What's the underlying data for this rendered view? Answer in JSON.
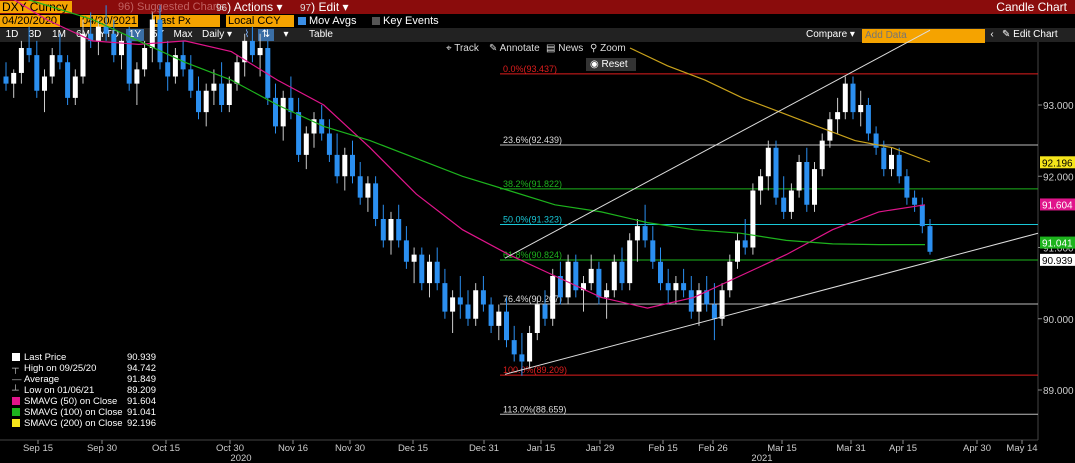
{
  "header": {
    "ticker": "DXY Curncy",
    "suggested_label": "Suggested Charts",
    "suggested_num": "96",
    "actions_label": "Actions",
    "actions_num": "96",
    "edit_label": "Edit",
    "edit_num": "97",
    "chart_type": "Candle Chart"
  },
  "controls": {
    "start_date": "04/20/2020",
    "end_date": "04/20/2021",
    "price_field": "Last Px",
    "currency": "Local CCY",
    "mov_avgs_label": "Mov Avgs",
    "key_events_label": "Key Events",
    "ranges": [
      "1D",
      "3D",
      "1M",
      "6M",
      "YTD",
      "1Y",
      "5Y",
      "Max"
    ],
    "selected_range": "1Y",
    "frequency": "Daily",
    "table_label": "Table",
    "compare_label": "Compare",
    "add_data_placeholder": "Add Data",
    "edit_chart_label": "Edit Chart"
  },
  "toolbar": {
    "track": "Track",
    "annotate": "Annotate",
    "news": "News",
    "zoom": "Zoom",
    "reset": "Reset"
  },
  "legend": [
    {
      "label": "Last Price",
      "value": "90.939",
      "marker": "square",
      "color": "#ffffff"
    },
    {
      "label": "High on 09/25/20",
      "value": "94.742",
      "marker": "high",
      "color": "#ffffff"
    },
    {
      "label": "Average",
      "value": "91.849",
      "marker": "avg",
      "color": "#ffffff"
    },
    {
      "label": "Low on 01/06/21",
      "value": "89.209",
      "marker": "low",
      "color": "#ffffff"
    },
    {
      "label": "SMAVG (50)  on Close",
      "value": "91.604",
      "marker": "square",
      "color": "#e0158b"
    },
    {
      "label": "SMAVG (100)  on Close",
      "value": "91.041",
      "marker": "square",
      "color": "#1db31d"
    },
    {
      "label": "SMAVG (200)  on Close",
      "value": "92.196",
      "marker": "square",
      "color": "#f5e51b"
    }
  ],
  "chart_data": {
    "type": "candlestick",
    "ylim": [
      88.3,
      94.1
    ],
    "y_ticks": [
      "93.000",
      "92.000",
      "91.000",
      "90.000",
      "89.000"
    ],
    "x_tick_labels": [
      "Sep 15",
      "Sep 30",
      "Oct 15",
      "Oct 30",
      "Nov 16",
      "Nov 30",
      "Dec 15",
      "Dec 31",
      "Jan 15",
      "Jan 29",
      "Feb 15",
      "Feb 26",
      "Mar 15",
      "Mar 31",
      "Apr 15",
      "Apr 30",
      "May 14"
    ],
    "year_labels": [
      "2020",
      "2021"
    ],
    "fib_levels": [
      {
        "label": "0.0%(93.437)",
        "value": 93.437,
        "color": "#e01e1e"
      },
      {
        "label": "23.6%(92.439)",
        "value": 92.439,
        "color": "#bbbbbb"
      },
      {
        "label": "38.2%(91.822)",
        "value": 91.822,
        "color": "#1db31d"
      },
      {
        "label": "50.0%(91.323)",
        "value": 91.323,
        "color": "#19c8d8"
      },
      {
        "label": "61.8%(90.824)",
        "value": 90.824,
        "color": "#1db31d"
      },
      {
        "label": "76.4%(90.207)",
        "value": 90.207,
        "color": "#bbbbbb"
      },
      {
        "label": "100.0%(89.209)",
        "value": 89.209,
        "color": "#e01e1e"
      },
      {
        "label": "113.0%(88.659)",
        "value": 88.659,
        "color": "#bbbbbb"
      }
    ],
    "price_tags": [
      {
        "label": "92.196",
        "value": 92.196,
        "bg": "#f5e51b",
        "fg": "#000000"
      },
      {
        "label": "91.604",
        "value": 91.604,
        "bg": "#e0158b",
        "fg": "#ffffff"
      },
      {
        "label": "91.041",
        "value": 91.041,
        "bg": "#1db31d",
        "fg": "#ffffff"
      },
      {
        "label": "90.939",
        "value": 90.939,
        "bg": "#ffffff",
        "fg": "#000000"
      }
    ],
    "trendlines": [
      {
        "name": "upper-channel",
        "from": [
          "Jan 06",
          90.85
        ],
        "to": [
          "Apr 15",
          94.0
        ]
      },
      {
        "name": "lower-channel",
        "from": [
          "Jan 06",
          89.22
        ],
        "to": [
          "May 14",
          91.2
        ]
      }
    ],
    "sma50": [
      94.6,
      94.2,
      93.9,
      93.85,
      93.9,
      93.75,
      93.35,
      93.0,
      92.4,
      91.75,
      91.25,
      90.9,
      90.6,
      90.3,
      90.15,
      90.3,
      90.6,
      90.9,
      91.25,
      91.5,
      91.6
    ],
    "sma100": [
      94.6,
      94.4,
      94.2,
      93.9,
      93.6,
      93.35,
      93.0,
      92.7,
      92.5,
      92.25,
      92.0,
      91.8,
      91.6,
      91.5,
      91.35,
      91.25,
      91.2,
      91.1,
      91.05,
      91.04,
      91.04
    ],
    "sma200": [
      93.8,
      93.55,
      93.35,
      93.1,
      92.9,
      92.7,
      92.5,
      92.4,
      92.2
    ],
    "candles": [
      [
        93.4,
        93.6,
        93.2,
        93.3
      ],
      [
        93.3,
        93.5,
        93.1,
        93.45
      ],
      [
        93.45,
        93.9,
        93.3,
        93.8
      ],
      [
        93.8,
        94.1,
        93.6,
        93.7
      ],
      [
        93.7,
        93.9,
        93.1,
        93.2
      ],
      [
        93.2,
        93.5,
        92.9,
        93.4
      ],
      [
        93.4,
        93.8,
        93.3,
        93.7
      ],
      [
        93.7,
        94.0,
        93.5,
        93.6
      ],
      [
        93.6,
        93.7,
        93.0,
        93.1
      ],
      [
        93.1,
        93.5,
        93.0,
        93.4
      ],
      [
        93.4,
        94.2,
        93.3,
        94.0
      ],
      [
        94.0,
        94.3,
        93.8,
        93.9
      ],
      [
        93.9,
        94.2,
        93.7,
        94.1
      ],
      [
        94.1,
        94.4,
        93.9,
        94.0
      ],
      [
        94.0,
        94.2,
        93.6,
        93.7
      ],
      [
        93.7,
        94.0,
        93.5,
        93.9
      ],
      [
        93.9,
        94.1,
        93.2,
        93.3
      ],
      [
        93.3,
        93.6,
        93.0,
        93.5
      ],
      [
        93.5,
        93.9,
        93.4,
        93.8
      ],
      [
        93.8,
        94.3,
        93.6,
        94.2
      ],
      [
        94.2,
        94.4,
        93.5,
        93.6
      ],
      [
        93.6,
        93.9,
        93.2,
        93.4
      ],
      [
        93.4,
        93.8,
        93.3,
        93.7
      ],
      [
        93.7,
        93.9,
        93.4,
        93.5
      ],
      [
        93.5,
        93.7,
        93.1,
        93.2
      ],
      [
        93.2,
        93.4,
        92.8,
        92.9
      ],
      [
        92.9,
        93.3,
        92.7,
        93.2
      ],
      [
        93.2,
        93.5,
        93.0,
        93.3
      ],
      [
        93.3,
        93.6,
        92.9,
        93.0
      ],
      [
        93.0,
        93.4,
        92.9,
        93.3
      ],
      [
        93.3,
        93.7,
        93.2,
        93.6
      ],
      [
        93.6,
        94.0,
        93.4,
        93.9
      ],
      [
        93.9,
        94.1,
        93.6,
        93.7
      ],
      [
        93.7,
        94.0,
        93.4,
        93.8
      ],
      [
        93.8,
        93.9,
        93.0,
        93.1
      ],
      [
        93.1,
        93.3,
        92.6,
        92.7
      ],
      [
        92.7,
        93.2,
        92.5,
        93.1
      ],
      [
        93.1,
        93.4,
        92.8,
        92.9
      ],
      [
        92.9,
        93.1,
        92.2,
        92.3
      ],
      [
        92.3,
        92.7,
        92.1,
        92.6
      ],
      [
        92.6,
        92.9,
        92.4,
        92.8
      ],
      [
        92.8,
        93.0,
        92.5,
        92.6
      ],
      [
        92.6,
        92.8,
        92.2,
        92.3
      ],
      [
        92.3,
        92.6,
        91.9,
        92.0
      ],
      [
        92.0,
        92.4,
        91.8,
        92.3
      ],
      [
        92.3,
        92.5,
        91.9,
        92.0
      ],
      [
        92.0,
        92.2,
        91.6,
        91.7
      ],
      [
        91.7,
        92.0,
        91.5,
        91.9
      ],
      [
        91.9,
        92.0,
        91.3,
        91.4
      ],
      [
        91.4,
        91.6,
        91.0,
        91.1
      ],
      [
        91.1,
        91.5,
        90.9,
        91.4
      ],
      [
        91.4,
        91.6,
        91.0,
        91.1
      ],
      [
        91.1,
        91.3,
        90.7,
        90.8
      ],
      [
        90.8,
        91.0,
        90.5,
        90.9
      ],
      [
        90.9,
        91.0,
        90.4,
        90.5
      ],
      [
        90.5,
        90.9,
        90.3,
        90.8
      ],
      [
        90.8,
        91.0,
        90.4,
        90.5
      ],
      [
        90.5,
        90.7,
        90.0,
        90.1
      ],
      [
        90.1,
        90.4,
        89.8,
        90.3
      ],
      [
        90.3,
        90.6,
        90.0,
        90.2
      ],
      [
        90.2,
        90.4,
        89.9,
        90.0
      ],
      [
        90.0,
        90.5,
        89.9,
        90.4
      ],
      [
        90.4,
        90.6,
        90.1,
        90.2
      ],
      [
        90.2,
        90.3,
        89.8,
        89.9
      ],
      [
        89.9,
        90.2,
        89.7,
        90.1
      ],
      [
        90.1,
        90.3,
        89.6,
        89.7
      ],
      [
        89.7,
        89.9,
        89.4,
        89.5
      ],
      [
        89.5,
        89.8,
        89.2,
        89.4
      ],
      [
        89.4,
        89.9,
        89.3,
        89.8
      ],
      [
        89.8,
        90.3,
        89.7,
        90.2
      ],
      [
        90.2,
        90.4,
        89.9,
        90.0
      ],
      [
        90.0,
        90.7,
        89.9,
        90.6
      ],
      [
        90.6,
        90.8,
        90.2,
        90.3
      ],
      [
        90.3,
        90.9,
        90.2,
        90.8
      ],
      [
        90.8,
        90.9,
        90.3,
        90.4
      ],
      [
        90.4,
        90.6,
        90.1,
        90.5
      ],
      [
        90.5,
        90.9,
        90.4,
        90.7
      ],
      [
        90.7,
        90.8,
        90.2,
        90.3
      ],
      [
        90.3,
        90.5,
        90.0,
        90.4
      ],
      [
        90.4,
        90.9,
        90.3,
        90.8
      ],
      [
        90.8,
        91.0,
        90.4,
        90.5
      ],
      [
        90.5,
        91.2,
        90.4,
        91.1
      ],
      [
        91.1,
        91.4,
        90.8,
        91.3
      ],
      [
        91.3,
        91.6,
        91.0,
        91.1
      ],
      [
        91.1,
        91.3,
        90.7,
        90.8
      ],
      [
        90.8,
        91.0,
        90.4,
        90.5
      ],
      [
        90.5,
        90.7,
        90.2,
        90.4
      ],
      [
        90.4,
        90.6,
        90.2,
        90.5
      ],
      [
        90.5,
        90.7,
        90.3,
        90.4
      ],
      [
        90.4,
        90.6,
        90.0,
        90.1
      ],
      [
        90.1,
        90.5,
        89.9,
        90.4
      ],
      [
        90.4,
        90.6,
        90.1,
        90.2
      ],
      [
        90.2,
        90.5,
        89.7,
        90.0
      ],
      [
        90.0,
        90.5,
        89.9,
        90.4
      ],
      [
        90.4,
        90.9,
        90.3,
        90.8
      ],
      [
        90.8,
        91.2,
        90.7,
        91.1
      ],
      [
        91.1,
        91.4,
        90.9,
        91.0
      ],
      [
        91.0,
        91.9,
        90.9,
        91.8
      ],
      [
        91.8,
        92.1,
        91.6,
        92.0
      ],
      [
        92.0,
        92.5,
        91.8,
        92.4
      ],
      [
        92.4,
        92.5,
        91.6,
        91.7
      ],
      [
        91.7,
        92.0,
        91.4,
        91.5
      ],
      [
        91.5,
        91.9,
        91.4,
        91.8
      ],
      [
        91.8,
        92.3,
        91.7,
        92.2
      ],
      [
        92.2,
        92.4,
        91.5,
        91.6
      ],
      [
        91.6,
        92.2,
        91.5,
        92.1
      ],
      [
        92.1,
        92.6,
        92.0,
        92.5
      ],
      [
        92.5,
        92.9,
        92.4,
        92.8
      ],
      [
        92.8,
        93.1,
        92.6,
        92.9
      ],
      [
        92.9,
        93.4,
        92.8,
        93.3
      ],
      [
        93.3,
        93.4,
        92.8,
        92.9
      ],
      [
        92.9,
        93.2,
        92.7,
        93.0
      ],
      [
        93.0,
        93.1,
        92.5,
        92.6
      ],
      [
        92.6,
        92.7,
        92.3,
        92.4
      ],
      [
        92.4,
        92.5,
        92.0,
        92.1
      ],
      [
        92.1,
        92.4,
        92.0,
        92.3
      ],
      [
        92.3,
        92.4,
        91.9,
        92.0
      ],
      [
        92.0,
        92.1,
        91.6,
        91.7
      ],
      [
        91.7,
        91.8,
        91.5,
        91.6
      ],
      [
        91.6,
        91.7,
        91.2,
        91.3
      ],
      [
        91.3,
        91.4,
        90.9,
        90.94
      ]
    ]
  }
}
